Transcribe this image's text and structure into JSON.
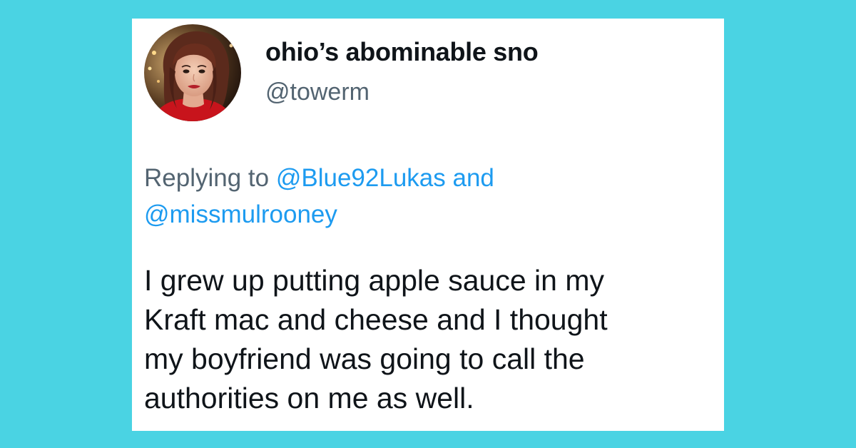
{
  "colors": {
    "background": "#4ad3e3",
    "card": "#ffffff",
    "text_primary": "#0f1419",
    "text_secondary": "#536471",
    "link": "#1d9bf0"
  },
  "author": {
    "display_name": "ohio’s abominable sno",
    "handle": "@towerm",
    "avatar_icon": "profile-photo"
  },
  "reply": {
    "prefix": "Replying to",
    "mention_1": "@Blue92Lukas",
    "conjunction": "and",
    "mention_2": "@missmulrooney"
  },
  "tweet": {
    "lines": [
      "I grew up putting apple sauce in my",
      "Kraft mac and cheese and I thought",
      "my boyfriend was going to call the",
      "authorities on me as well."
    ]
  }
}
